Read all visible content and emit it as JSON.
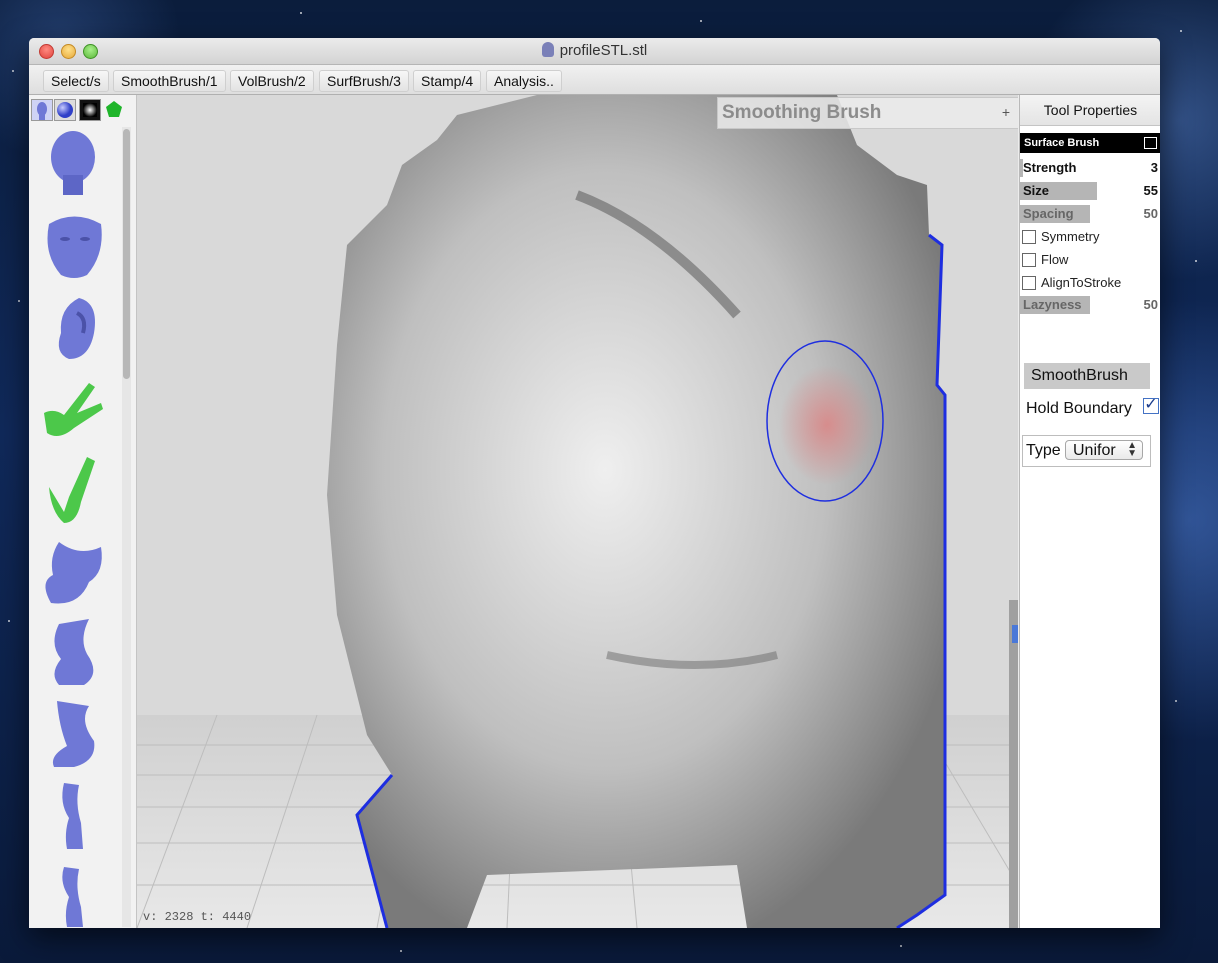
{
  "window": {
    "title": "profileSTL.stl"
  },
  "menu": [
    "Select/s",
    "SmoothBrush/1",
    "VolBrush/2",
    "SurfBrush/3",
    "Stamp/4",
    "Analysis.."
  ],
  "left_panel": {
    "tab_icons": [
      "head-icon",
      "sphere-icon",
      "square-icon",
      "pentagon-icon"
    ],
    "thumbnails": [
      {
        "name": "head",
        "color": "#6f78d6"
      },
      {
        "name": "face",
        "color": "#6f78d6"
      },
      {
        "name": "ear",
        "color": "#6f78d6"
      },
      {
        "name": "hand-peace",
        "color": "#4cc84a"
      },
      {
        "name": "hand-point",
        "color": "#4cc84a"
      },
      {
        "name": "foot",
        "color": "#6f78d6"
      },
      {
        "name": "leg",
        "color": "#6f78d6"
      },
      {
        "name": "leg-2",
        "color": "#6f78d6"
      },
      {
        "name": "leg-3",
        "color": "#6f78d6"
      },
      {
        "name": "leg-4",
        "color": "#6f78d6"
      }
    ]
  },
  "viewport": {
    "brush_title": "Smoothing Brush",
    "plus": "+",
    "status": "v: 2328 t: 4440",
    "brush_color": "#1e2ee0",
    "highlight_color": "#d88a8a"
  },
  "tool_properties": {
    "header": "Tool Properties",
    "section": "Surface Brush",
    "sliders": [
      {
        "label": "Strength",
        "value": "3",
        "fill": 0.03,
        "dim": false
      },
      {
        "label": "Size",
        "value": "55",
        "fill": 0.55,
        "dim": false
      },
      {
        "label": "Spacing",
        "value": "50",
        "fill": 0.5,
        "dim": true
      }
    ],
    "checkboxes": [
      {
        "label": "Symmetry",
        "checked": false
      },
      {
        "label": "Flow",
        "checked": false
      },
      {
        "label": "AlignToStroke",
        "checked": false
      }
    ],
    "lazyness": {
      "label": "Lazyness",
      "value": "50",
      "fill": 0.5
    },
    "smooth_button": "SmoothBrush",
    "hold_boundary": {
      "label": "Hold Boundary",
      "checked": true
    },
    "type": {
      "label": "Type",
      "value": "Unifor"
    }
  }
}
